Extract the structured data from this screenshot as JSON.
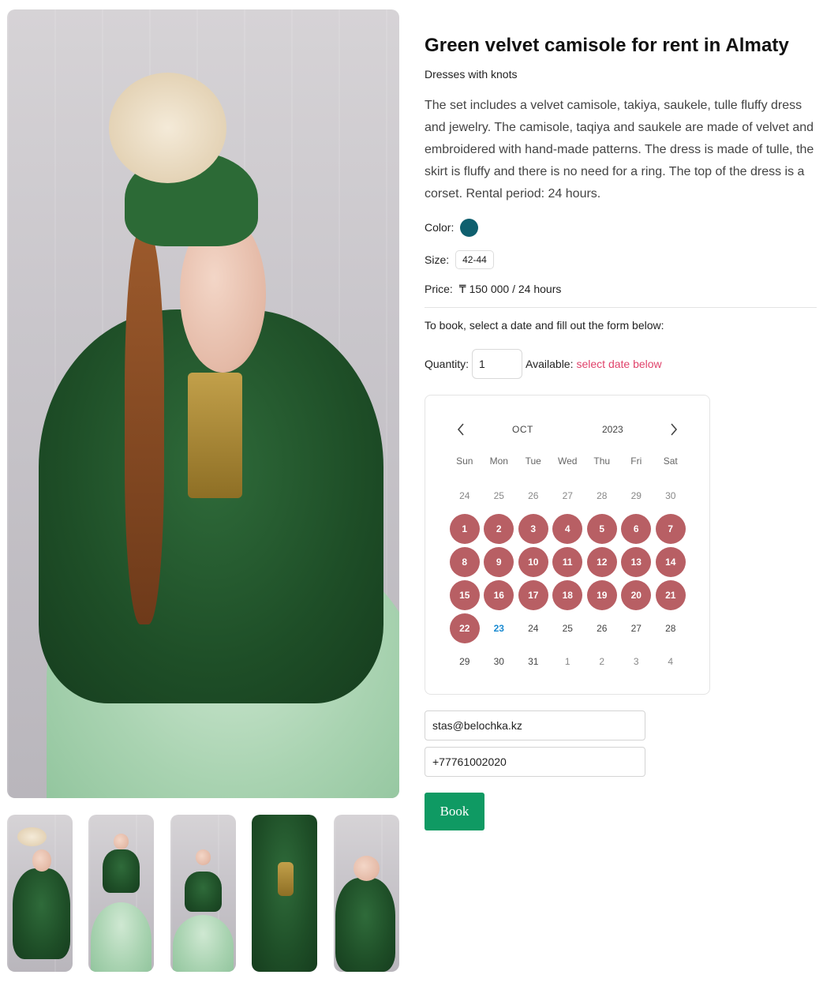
{
  "product": {
    "title": "Green velvet camisole for rent in Almaty",
    "category": "Dresses with knots",
    "description": "The set includes a velvet camisole, takiya, saukele, tulle fluffy dress and jewelry. The camisole, taqiya and saukele are made of velvet and embroidered with hand-made patterns. The dress is made of tulle, the skirt is fluffy and there is no need for a ring. The top of the dress is a corset. Rental period: 24 hours.",
    "color_label": "Color:",
    "color_value": "#0f5f6e",
    "size_label": "Size:",
    "size_value": "42-44",
    "price_label": "Price:",
    "price_value": "₸ 150 000 / 24 hours"
  },
  "booking": {
    "instruction": "To book, select a date and fill out the form below:",
    "quantity_label": "Quantity:",
    "quantity_value": "1",
    "available_label": "Available:",
    "available_link": "select date below"
  },
  "calendar": {
    "month": "OCT",
    "year": "2023",
    "prev_icon": "chevron-left-icon",
    "next_icon": "chevron-right-icon",
    "weekdays": [
      "Sun",
      "Mon",
      "Tue",
      "Wed",
      "Thu",
      "Fri",
      "Sat"
    ],
    "days": [
      {
        "label": "24",
        "state": "muted"
      },
      {
        "label": "25",
        "state": "muted"
      },
      {
        "label": "26",
        "state": "muted"
      },
      {
        "label": "27",
        "state": "muted"
      },
      {
        "label": "28",
        "state": "muted"
      },
      {
        "label": "29",
        "state": "muted"
      },
      {
        "label": "30",
        "state": "muted"
      },
      {
        "label": "1",
        "state": "booked"
      },
      {
        "label": "2",
        "state": "booked"
      },
      {
        "label": "3",
        "state": "booked"
      },
      {
        "label": "4",
        "state": "booked"
      },
      {
        "label": "5",
        "state": "booked"
      },
      {
        "label": "6",
        "state": "booked"
      },
      {
        "label": "7",
        "state": "booked"
      },
      {
        "label": "8",
        "state": "booked"
      },
      {
        "label": "9",
        "state": "booked"
      },
      {
        "label": "10",
        "state": "booked"
      },
      {
        "label": "11",
        "state": "booked"
      },
      {
        "label": "12",
        "state": "booked"
      },
      {
        "label": "13",
        "state": "booked"
      },
      {
        "label": "14",
        "state": "booked"
      },
      {
        "label": "15",
        "state": "booked"
      },
      {
        "label": "16",
        "state": "booked"
      },
      {
        "label": "17",
        "state": "booked"
      },
      {
        "label": "18",
        "state": "booked"
      },
      {
        "label": "19",
        "state": "booked"
      },
      {
        "label": "20",
        "state": "booked"
      },
      {
        "label": "21",
        "state": "booked"
      },
      {
        "label": "22",
        "state": "booked"
      },
      {
        "label": "23",
        "state": "today"
      },
      {
        "label": "24",
        "state": "normal"
      },
      {
        "label": "25",
        "state": "normal"
      },
      {
        "label": "26",
        "state": "normal"
      },
      {
        "label": "27",
        "state": "normal"
      },
      {
        "label": "28",
        "state": "normal"
      },
      {
        "label": "29",
        "state": "normal"
      },
      {
        "label": "30",
        "state": "normal"
      },
      {
        "label": "31",
        "state": "normal"
      },
      {
        "label": "1",
        "state": "muted"
      },
      {
        "label": "2",
        "state": "muted"
      },
      {
        "label": "3",
        "state": "muted"
      },
      {
        "label": "4",
        "state": "muted"
      }
    ],
    "colors": {
      "booked": "#b85f64",
      "today": "#1a8ad1",
      "muted": "#888888"
    }
  },
  "form": {
    "email_value": "stas@belochka.kz",
    "phone_value": "+77761002020",
    "book_label": "Book",
    "button_color": "#0f9a63"
  },
  "gallery": {
    "thumb_count": 5
  }
}
